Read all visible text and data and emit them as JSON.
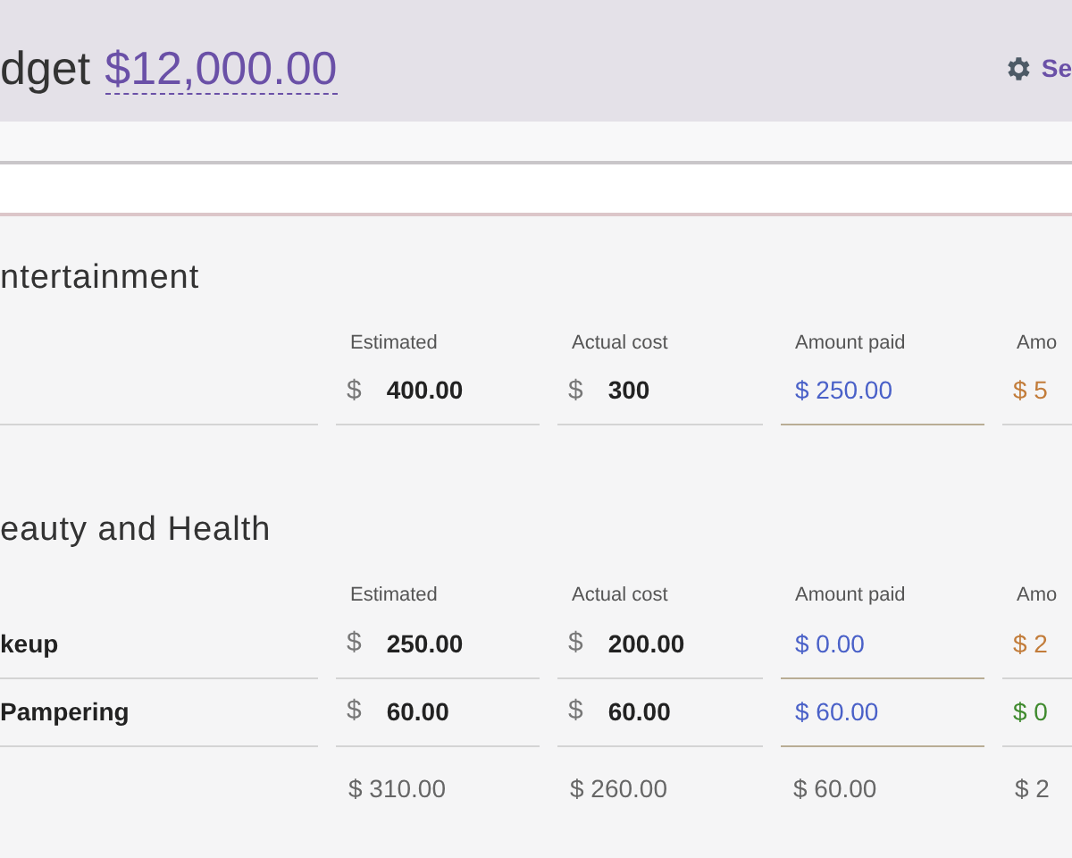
{
  "header": {
    "title": "dget",
    "budget": "$12,000.00",
    "settings_link": "Se"
  },
  "sections": [
    {
      "title": "ntertainment",
      "columns": [
        "Estimated",
        "Actual cost",
        "Amount paid",
        "Amo"
      ],
      "rows": [
        {
          "estimated_currency": "$",
          "estimated": "400.00",
          "actual_currency": "$",
          "actual": "300",
          "paid": "$ 250.00",
          "remaining": "$ 5",
          "color": "#c27c3a"
        }
      ]
    },
    {
      "title": "eauty and Health",
      "columns": [
        "Estimated",
        "Actual cost",
        "Amount paid",
        "Amo"
      ],
      "rows": [
        {
          "name": "keup",
          "estimated_currency": "$",
          "estimated": "250.00",
          "actual_currency": "$",
          "actual": "200.00",
          "paid": "$ 0.00",
          "remaining": "$ 2",
          "color": "#c27c3a"
        },
        {
          "name": "Pampering",
          "estimated_currency": "$",
          "estimated": "60.00",
          "actual_currency": "$",
          "actual": "60.00",
          "paid": "$ 60.00",
          "remaining": "$ 0",
          "color": "#3f8a2e"
        }
      ],
      "totals": [
        "$ 310.00",
        "$ 260.00",
        "$ 60.00",
        "$ 2"
      ]
    }
  ]
}
